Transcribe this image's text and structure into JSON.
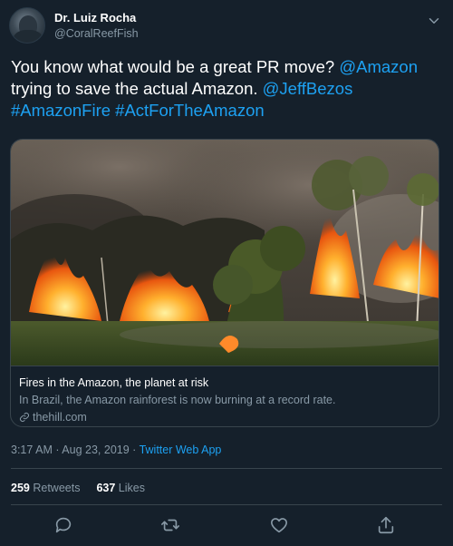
{
  "author": {
    "name": "Dr. Luiz Rocha",
    "handle": "@CoralReefFish"
  },
  "tweet": {
    "text_part1": "You know what would be a great PR move? ",
    "mention_amazon": "@Amazon",
    "text_part2": " trying to save the actual Amazon. ",
    "mention_bezos": "@JeffBezos",
    "hashtag1": "#AmazonFire",
    "hashtag2": "#ActForTheAmazon"
  },
  "card": {
    "title": "Fires in the Amazon, the planet at risk",
    "description": "In Brazil, the Amazon rainforest is now burning at a record rate.",
    "domain": "thehill.com"
  },
  "meta": {
    "time": "3:17 AM",
    "separator1": " · ",
    "date": "Aug 23, 2019",
    "separator2": " · ",
    "app": "Twitter Web App"
  },
  "stats": {
    "retweets_count": "259",
    "retweets_label": "Retweets",
    "likes_count": "637",
    "likes_label": "Likes"
  },
  "icons": {
    "reply": "reply-icon",
    "retweet": "retweet-icon",
    "like": "heart-icon",
    "share": "share-icon",
    "more": "chevron-down-icon",
    "link": "link-icon"
  },
  "colors": {
    "background": "#15202b",
    "accent": "#1da1f2",
    "secondary_text": "#8899a6",
    "border": "#38444d"
  }
}
